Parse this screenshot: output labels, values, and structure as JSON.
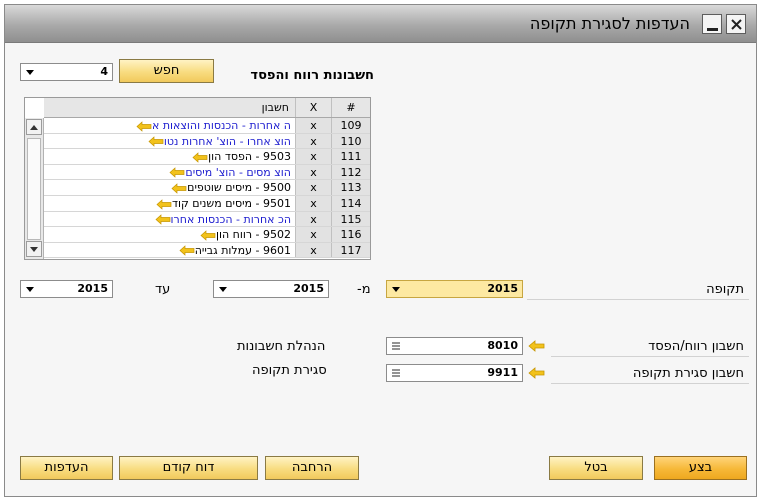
{
  "window": {
    "title": "העדפות לסגירת תקופה"
  },
  "accounts_section": {
    "heading": "חשבונות רווח והפסד",
    "count_value": "4",
    "search_button": "חפש"
  },
  "grid": {
    "headers": {
      "number": "#",
      "x": "X",
      "account": "חשבון"
    },
    "rows": [
      {
        "num": "109",
        "x": "x",
        "account": "ה אחרות - הכנסות והוצאות א",
        "link": true
      },
      {
        "num": "110",
        "x": "x",
        "account": "הוצ אחרו - הוצ' אחרות נטו",
        "link": true
      },
      {
        "num": "111",
        "x": "x",
        "account": "9503 - הפסד הון",
        "link": false
      },
      {
        "num": "112",
        "x": "x",
        "account": "הוצ מסים - הוצ' מיסים",
        "link": true
      },
      {
        "num": "113",
        "x": "x",
        "account": "9500 - מיסים שוטפים",
        "link": false
      },
      {
        "num": "114",
        "x": "x",
        "account": "9501 - מיסים משנים קוד",
        "link": false
      },
      {
        "num": "115",
        "x": "x",
        "account": "הכ אחרות - הכנסות אחרו",
        "link": true
      },
      {
        "num": "116",
        "x": "x",
        "account": "9502 - רווח הון",
        "link": false
      },
      {
        "num": "117",
        "x": "x",
        "account": "9601 - עמלות גבייה",
        "link": false
      }
    ]
  },
  "period": {
    "label": "תקופה",
    "value": "2015",
    "from_label": "מ-",
    "from_value": "2015",
    "to_label": "עד",
    "to_value": "2015"
  },
  "pl_account": {
    "label": "חשבון רווח/הפסד",
    "value": "8010",
    "name": "הנהלת חשבונות"
  },
  "closing_account": {
    "label": "חשבון סגירת תקופה",
    "value": "9911",
    "name": "סגירת תקופה"
  },
  "buttons": {
    "execute": "בצע",
    "cancel": "בטל",
    "expand": "הרחבה",
    "previous_report": "דוח קודם",
    "preferences": "העדפות"
  },
  "colors": {
    "link": "#1d1dcf",
    "arrow": "#f2c21b",
    "primary": "#f6b838"
  }
}
